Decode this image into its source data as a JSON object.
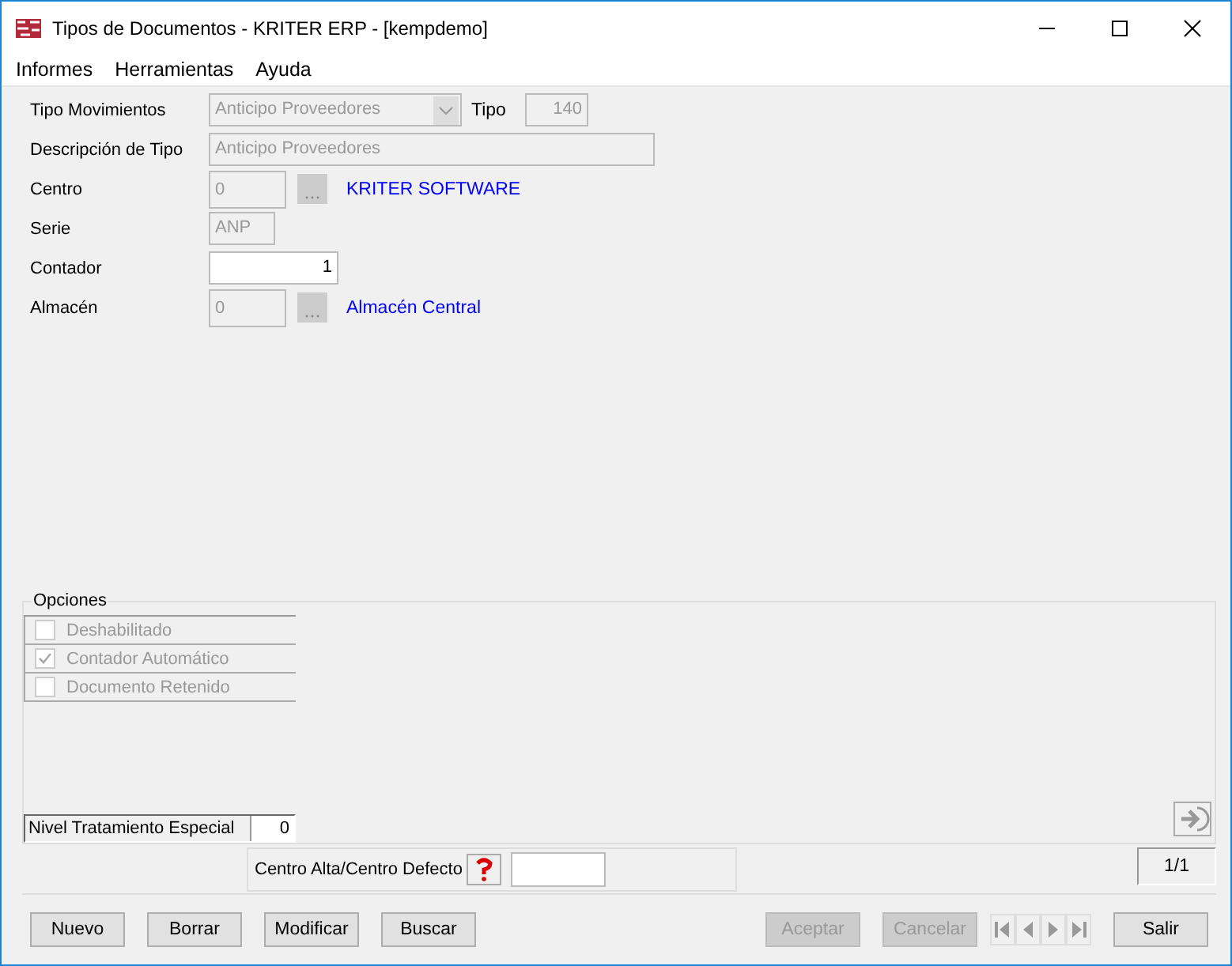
{
  "window": {
    "title": "Tipos de Documentos - KRITER ERP - [kempdemo]"
  },
  "menu": [
    "Informes",
    "Herramientas",
    "Ayuda"
  ],
  "fields": [
    {
      "kind": "combo",
      "label": "Tipo Movimientos",
      "value": "Anticipo Proveedores",
      "disabled": true,
      "extra_label": "Tipo",
      "extra_value": "140"
    },
    {
      "kind": "text",
      "label": "Descripción de Tipo",
      "value": "Anticipo Proveedores",
      "disabled": true
    },
    {
      "kind": "lookup",
      "label": "Centro",
      "value": "0",
      "disabled": true,
      "link": "KRITER SOFTWARE"
    },
    {
      "kind": "text",
      "label": "Serie",
      "value": "ANP",
      "disabled": true
    },
    {
      "kind": "number",
      "label": "Contador",
      "value": "1",
      "disabled": false
    },
    {
      "kind": "lookup",
      "label": "Almacén",
      "value": "0",
      "disabled": true,
      "link": "Almacén Central"
    }
  ],
  "options": {
    "title": "Opciones",
    "checks": [
      {
        "label": "Deshabilitado",
        "checked": false,
        "disabled": true
      },
      {
        "label": "Contador Automático",
        "checked": true,
        "disabled": true
      },
      {
        "label": "Documento Retenido",
        "checked": false,
        "disabled": true
      }
    ],
    "level_label": "Nivel Tratamiento Especial",
    "level_value": "0"
  },
  "centro_alta": {
    "label": "Centro Alta/Centro Defecto"
  },
  "record": "1/1",
  "buttons": [
    {
      "label": "Nuevo",
      "disabled": false
    },
    {
      "label": "Borrar",
      "disabled": false
    },
    {
      "label": "Modificar",
      "disabled": false
    },
    {
      "label": "Buscar",
      "disabled": false
    },
    {
      "label": "Aceptar",
      "disabled": true
    },
    {
      "label": "Cancelar",
      "disabled": true
    },
    {
      "label": "Salir",
      "disabled": false
    }
  ]
}
